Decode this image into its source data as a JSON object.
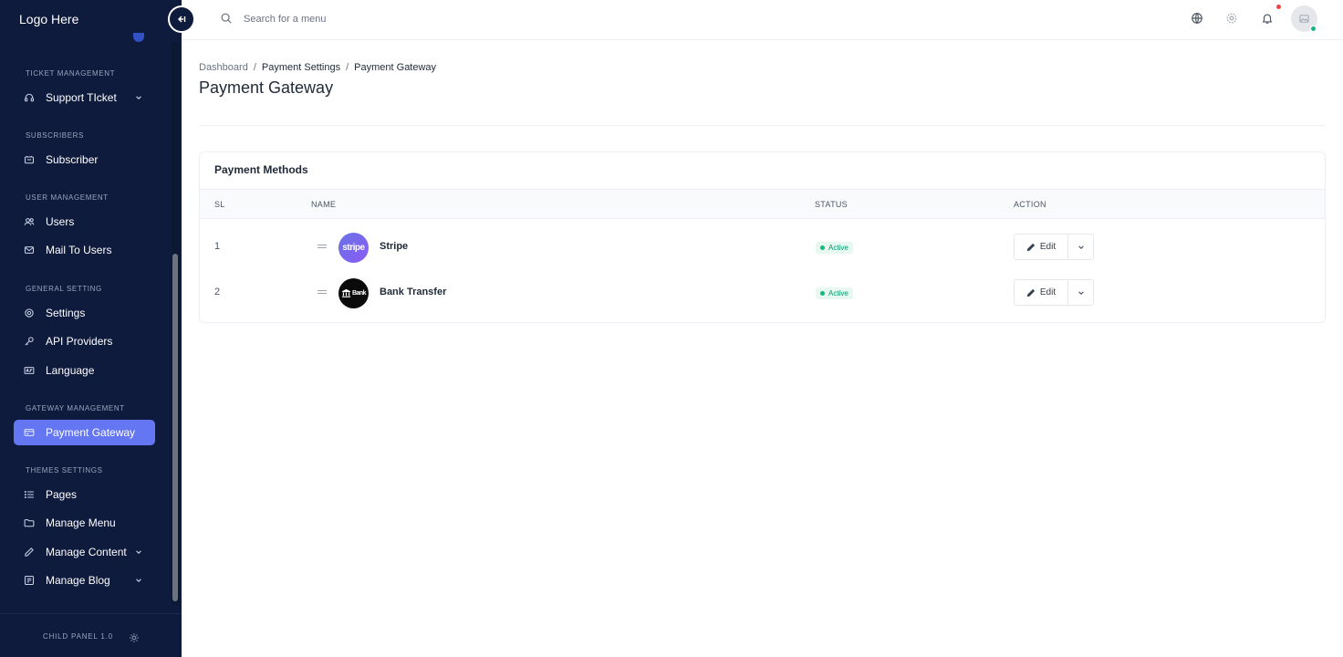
{
  "app": {
    "logo_text": "Logo Here",
    "version": "CHILD PANEL 1.0"
  },
  "sidebar": {
    "sections": [
      {
        "title": "TICKET MANAGEMENT",
        "items": [
          {
            "label": "Support TIcket",
            "icon": "headset-icon",
            "has_children": true
          }
        ]
      },
      {
        "title": "SUBSCRIBERS",
        "items": [
          {
            "label": "Subscriber",
            "icon": "subscriber-icon",
            "has_children": false
          }
        ]
      },
      {
        "title": "USER MANAGEMENT",
        "items": [
          {
            "label": "Users",
            "icon": "users-icon",
            "has_children": false
          },
          {
            "label": "Mail To Users",
            "icon": "mail-icon",
            "has_children": false
          }
        ]
      },
      {
        "title": "GENERAL SETTING",
        "items": [
          {
            "label": "Settings",
            "icon": "gear-icon",
            "has_children": false
          },
          {
            "label": "API Providers",
            "icon": "key-icon",
            "has_children": false
          },
          {
            "label": "Language",
            "icon": "language-icon",
            "has_children": false
          }
        ]
      },
      {
        "title": "GATEWAY MANAGEMENT",
        "items": [
          {
            "label": "Payment Gateway",
            "icon": "card-icon",
            "has_children": false,
            "active": true
          }
        ]
      },
      {
        "title": "THEMES SETTINGS",
        "items": [
          {
            "label": "Pages",
            "icon": "list-icon",
            "has_children": false
          },
          {
            "label": "Manage Menu",
            "icon": "folder-icon",
            "has_children": false
          },
          {
            "label": "Manage Content",
            "icon": "pen-icon",
            "has_children": true
          },
          {
            "label": "Manage Blog",
            "icon": "blog-icon",
            "has_children": true
          }
        ]
      }
    ]
  },
  "header": {
    "search_placeholder": "Search for a menu",
    "icons": [
      "globe-icon",
      "settings-icon",
      "bell-icon",
      "avatar"
    ]
  },
  "breadcrumb": {
    "items": [
      "Dashboard",
      "Payment Settings",
      "Payment Gateway"
    ]
  },
  "page": {
    "title": "Payment Gateway"
  },
  "card": {
    "title": "Payment Methods",
    "columns": {
      "sl": "SL",
      "name": "NAME",
      "status": "STATUS",
      "action": "ACTION"
    },
    "rows": [
      {
        "sl": "1",
        "name": "Stripe",
        "logo_text": "stripe",
        "status": "Active",
        "action": "Edit"
      },
      {
        "sl": "2",
        "name": "Bank Transfer",
        "logo_text": "Bank",
        "status": "Active",
        "action": "Edit"
      }
    ]
  },
  "colors": {
    "sidebar_bg": "#0f1b3d",
    "active_item": "#6476f2",
    "status_green": "#10b981",
    "notification_red": "#ef4444"
  }
}
